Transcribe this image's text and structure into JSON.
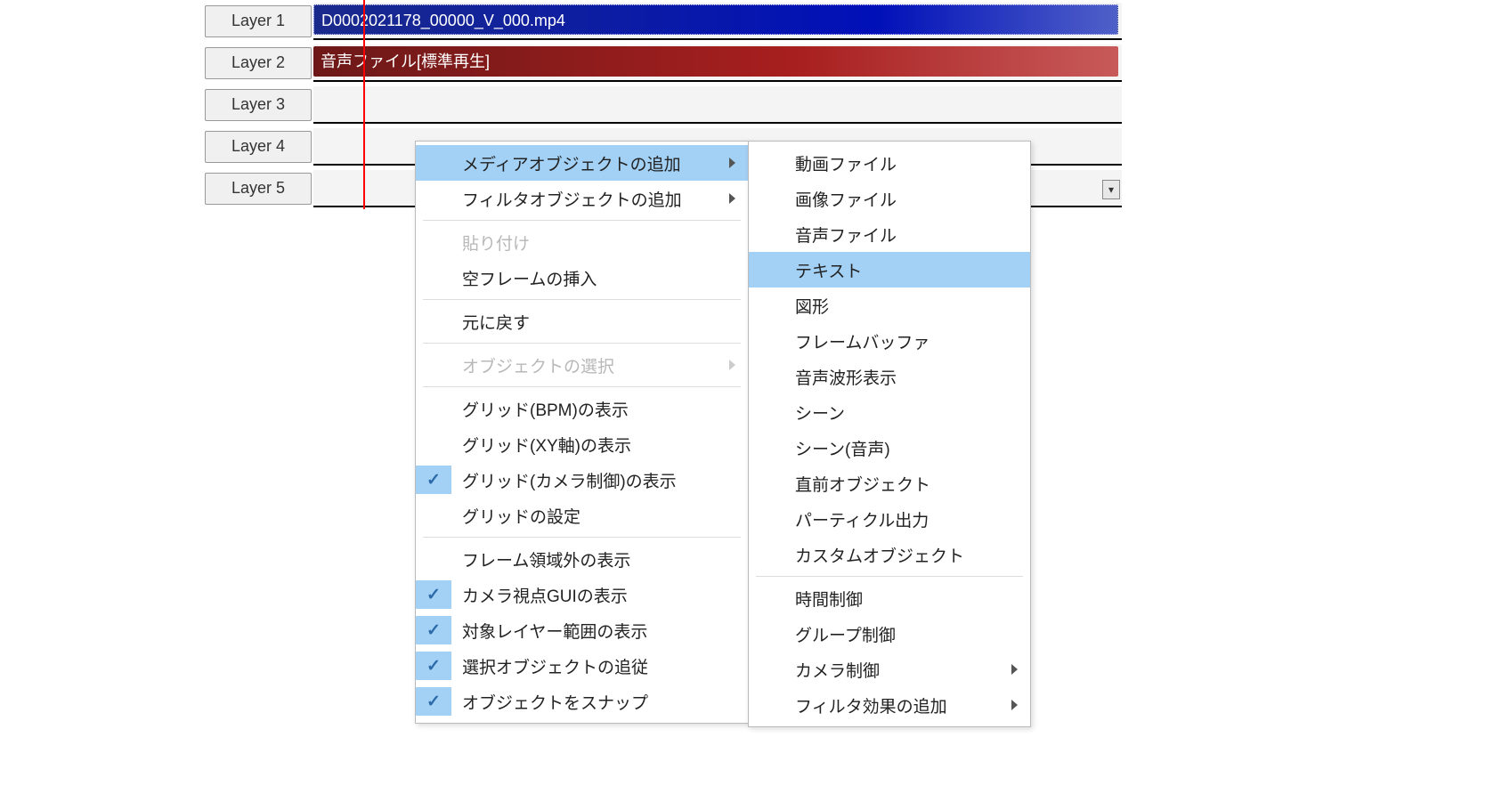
{
  "timeline": {
    "layers": [
      {
        "name": "Layer 1"
      },
      {
        "name": "Layer 2"
      },
      {
        "name": "Layer 3"
      },
      {
        "name": "Layer 4"
      },
      {
        "name": "Layer 5"
      }
    ],
    "video_clip_label": "D0002021178_00000_V_000.mp4",
    "audio_clip_label": "音声ファイル[標準再生]"
  },
  "context_menu": {
    "items": [
      {
        "label": "メディアオブジェクトの追加",
        "highlight": true,
        "has_submenu": true
      },
      {
        "label": "フィルタオブジェクトの追加",
        "has_submenu": true
      },
      "sep",
      {
        "label": "貼り付け",
        "disabled": true
      },
      {
        "label": "空フレームの挿入"
      },
      "sep",
      {
        "label": "元に戻す"
      },
      "sep",
      {
        "label": "オブジェクトの選択",
        "disabled": true,
        "has_submenu": true
      },
      "sep",
      {
        "label": "グリッド(BPM)の表示"
      },
      {
        "label": "グリッド(XY軸)の表示"
      },
      {
        "label": "グリッド(カメラ制御)の表示",
        "checked": true
      },
      {
        "label": "グリッドの設定"
      },
      "sep",
      {
        "label": "フレーム領域外の表示"
      },
      {
        "label": "カメラ視点GUIの表示",
        "checked": true
      },
      {
        "label": "対象レイヤー範囲の表示",
        "checked": true
      },
      {
        "label": "選択オブジェクトの追従",
        "checked": true
      },
      {
        "label": "オブジェクトをスナップ",
        "checked": true
      }
    ]
  },
  "sub_menu": {
    "items": [
      {
        "label": "動画ファイル"
      },
      {
        "label": "画像ファイル"
      },
      {
        "label": "音声ファイル"
      },
      {
        "label": "テキスト",
        "highlight": true
      },
      {
        "label": "図形"
      },
      {
        "label": "フレームバッファ"
      },
      {
        "label": "音声波形表示"
      },
      {
        "label": "シーン"
      },
      {
        "label": "シーン(音声)"
      },
      {
        "label": "直前オブジェクト"
      },
      {
        "label": "パーティクル出力"
      },
      {
        "label": "カスタムオブジェクト"
      },
      "sep",
      {
        "label": "時間制御"
      },
      {
        "label": "グループ制御"
      },
      {
        "label": "カメラ制御",
        "has_submenu": true
      },
      {
        "label": "フィルタ効果の追加",
        "has_submenu": true
      }
    ]
  }
}
